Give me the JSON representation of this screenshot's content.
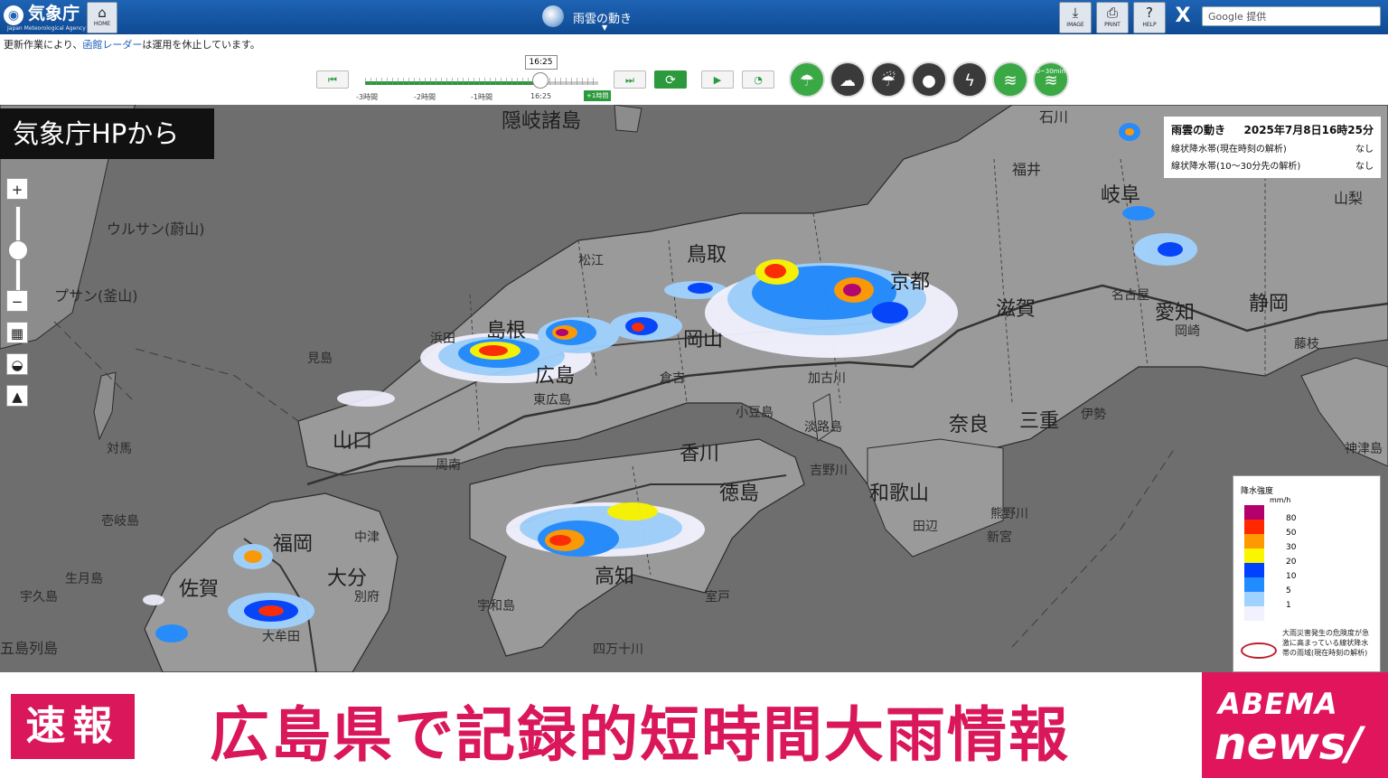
{
  "header": {
    "logo_text": "気象庁",
    "logo_sub": "Japan Meteorological Agency",
    "home_label": "HOME",
    "page_title": "雨雲の動き",
    "tools": [
      {
        "label": "IMAGE",
        "icon": "download-icon"
      },
      {
        "label": "PRINT",
        "icon": "print-icon"
      },
      {
        "label": "HELP",
        "icon": "help-icon"
      }
    ],
    "x_label": "X",
    "search_text": "Google 提供"
  },
  "notice": {
    "prefix": "更新作業により、",
    "link": "函館レーダー",
    "suffix": "は運用を休止しています。"
  },
  "slider": {
    "current_time": "16:25",
    "ticks": [
      "-3時間",
      "-2時間",
      "-1時間",
      "16:25"
    ],
    "forward_label": "+1時間",
    "position_fraction": 0.75
  },
  "layer_annotation": "10~30min",
  "overlay_label": "気象庁HPから",
  "info_box": {
    "title": "雨雲の動き",
    "datetime": "2025年7月8日16時25分",
    "rows": [
      {
        "label": "線状降水帯(現在時刻の解析)",
        "value": "なし"
      },
      {
        "label": "線状降水帯(10～30分先の解析)",
        "value": "なし"
      }
    ]
  },
  "legend": {
    "title": "降水強度",
    "unit": "mm/h",
    "levels": [
      {
        "label": "80",
        "color": "#b4006c"
      },
      {
        "label": "50",
        "color": "#ff2800"
      },
      {
        "label": "30",
        "color": "#ff9900"
      },
      {
        "label": "20",
        "color": "#faf500"
      },
      {
        "label": "10",
        "color": "#0041ff"
      },
      {
        "label": "5",
        "color": "#218cff"
      },
      {
        "label": "1",
        "color": "#a0d2ff"
      },
      {
        "label": "",
        "color": "#f2f2ff"
      }
    ],
    "note": "大雨災害発生の危険度が急激に高まっている線状降水帯の雨域(現在時刻の解析)"
  },
  "map_labels": {
    "large": [
      {
        "text": "鳥取"
      },
      {
        "text": "京都"
      },
      {
        "text": "岐阜"
      },
      {
        "text": "滋賀"
      },
      {
        "text": "愛知"
      },
      {
        "text": "静岡"
      },
      {
        "text": "広島"
      },
      {
        "text": "山口"
      },
      {
        "text": "福岡"
      },
      {
        "text": "大分"
      },
      {
        "text": "佐賀"
      },
      {
        "text": "高知"
      },
      {
        "text": "徳島"
      },
      {
        "text": "奈良"
      },
      {
        "text": "三重"
      },
      {
        "text": "和歌山"
      },
      {
        "text": "隠岐諸島"
      },
      {
        "text": "島根"
      },
      {
        "text": "岡山"
      },
      {
        "text": "香川"
      }
    ],
    "medium": [
      {
        "text": "ウルサン(蔚山)"
      },
      {
        "text": "プサン(釜山)"
      },
      {
        "text": "対馬"
      },
      {
        "text": "壱岐島"
      },
      {
        "text": "五島列島"
      },
      {
        "text": "見島"
      },
      {
        "text": "福井"
      },
      {
        "text": "石川"
      },
      {
        "text": "山梨"
      },
      {
        "text": "東広島"
      },
      {
        "text": "周南"
      },
      {
        "text": "宇和島"
      },
      {
        "text": "室戸"
      },
      {
        "text": "新宮"
      },
      {
        "text": "田辺"
      },
      {
        "text": "神津島"
      },
      {
        "text": "大牟田"
      },
      {
        "text": "中津"
      },
      {
        "text": "別府"
      },
      {
        "text": "四万十川"
      },
      {
        "text": "吉野川"
      },
      {
        "text": "熊野川"
      },
      {
        "text": "浜田"
      },
      {
        "text": "松江"
      },
      {
        "text": "倉吉"
      },
      {
        "text": "加古川"
      },
      {
        "text": "小豆島"
      },
      {
        "text": "淡路島"
      },
      {
        "text": "生月島"
      },
      {
        "text": "宇久島"
      },
      {
        "text": "伊勢"
      },
      {
        "text": "名古屋"
      },
      {
        "text": "岡崎"
      },
      {
        "text": "藤枝"
      }
    ]
  },
  "banner": {
    "badge": "速報",
    "headline": "広島県で記録的短時間大雨情報",
    "brand_top": "ABEMA",
    "brand_bottom": "news/"
  }
}
